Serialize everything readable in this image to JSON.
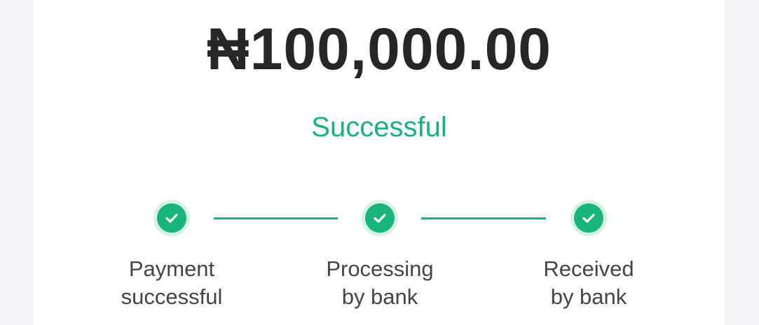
{
  "transaction": {
    "amount": "₦100,000.00",
    "status": "Successful",
    "status_color": "#19b27b"
  },
  "steps": [
    {
      "line1": "Payment",
      "line2": "successful",
      "icon": "check-circle-icon",
      "completed": true
    },
    {
      "line1": "Processing",
      "line2": "by bank",
      "icon": "check-circle-icon",
      "completed": true
    },
    {
      "line1": "Received",
      "line2": "by bank",
      "icon": "check-circle-icon",
      "completed": true
    }
  ],
  "colors": {
    "accent": "#18b57b",
    "accent_light": "#d6f2e6",
    "text": "#262626",
    "label": "#454545",
    "background": "#f3f3f8",
    "card": "#ffffff"
  }
}
